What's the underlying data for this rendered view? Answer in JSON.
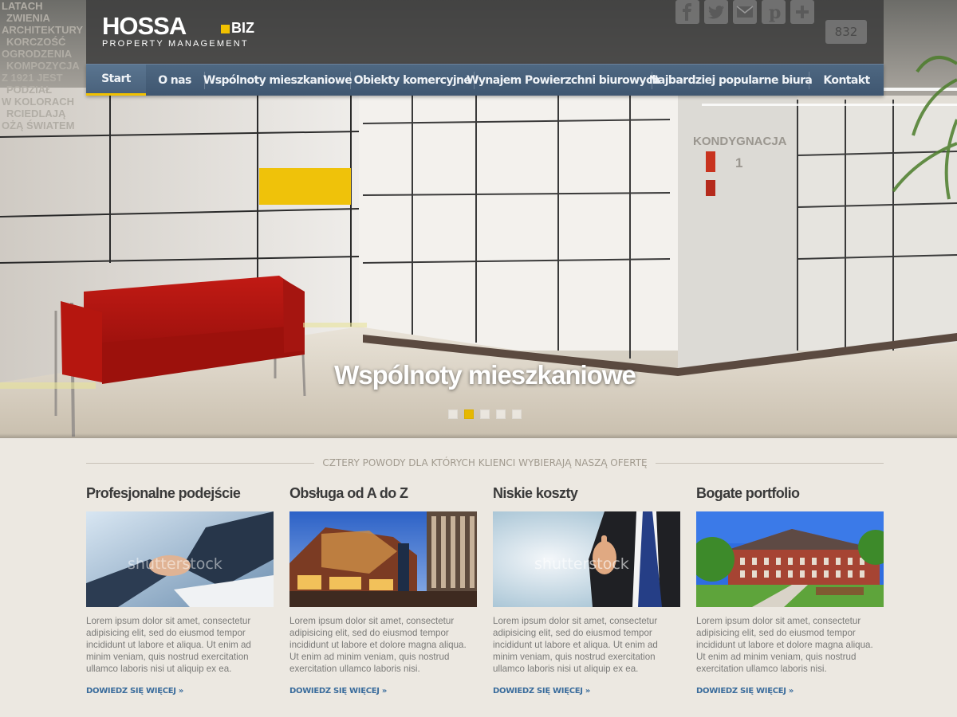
{
  "brand": {
    "name": "HOSSA",
    "tld": "BIZ",
    "tagline": "PROPERTY MANAGEMENT"
  },
  "social": {
    "icons": [
      "facebook-icon",
      "twitter-icon",
      "email-icon",
      "pinterest-icon",
      "plus-icon"
    ],
    "counter": "832"
  },
  "nav": {
    "items": [
      "Start",
      "O nas",
      "Wspólnoty mieszkaniowe",
      "Obiekty komercyjne",
      "Wynajem Powierzchni biurowych",
      "Najbardziej popularne biura",
      "Kontakt"
    ],
    "active_index": 0
  },
  "hero": {
    "caption": "Wspólnoty mieszkaniowe",
    "slides_count": 5,
    "active_slide": 1,
    "wall_sign": "KONDYGNACJA",
    "wall_number": "1",
    "wall_text_lines": [
      "LATACH",
      "ZWIENIA",
      "ARCHITEKTURY",
      "KORCZOŚĆ",
      "OGRODZENIA",
      "KOMPOZYCJA",
      "Z 1921 JEST",
      "PODZIAŁ",
      "W KOLORACH",
      "RCIEDLAJĄ",
      "OŻĄ ŚWIATEM"
    ]
  },
  "reasons": {
    "section_title": "CZTERY POWODY DLA KTÓRYCH KLIENCI WYBIERAJĄ NASZĄ OFERTĘ",
    "more_label": "DOWIEDZ SIĘ WIĘCEJ »",
    "watermark": "shutterstock",
    "items": [
      {
        "title": "Profesjonalne podejście",
        "text": "Lorem ipsum dolor sit amet, consectetur adipisicing elit, sed do eiusmod tempor incididunt ut labore et aliqua. Ut enim ad minim veniam, quis nostrud exercitation ullamco laboris nisi ut aliquip ex ea."
      },
      {
        "title": "Obsługa od A do Z",
        "text": "Lorem ipsum dolor sit amet, consectetur adipisicing elit, sed do eiusmod tempor incididunt ut labore et dolore magna aliqua. Ut enim ad minim veniam, quis nostrud exercitation ullamco laboris nisi."
      },
      {
        "title": "Niskie koszty",
        "text": "Lorem ipsum dolor sit amet, consectetur adipisicing elit, sed do eiusmod tempor incididunt ut labore et aliqua. Ut enim ad minim veniam, quis nostrud exercitation ullamco laboris nisi ut aliquip ex ea."
      },
      {
        "title": "Bogate portfolio",
        "text": "Lorem ipsum dolor sit amet, consectetur adipisicing elit, sed do eiusmod tempor incididunt ut labore et dolore magna aliqua. Ut enim ad minim veniam, quis nostrud exercitation ullamco laboris nisi."
      }
    ]
  },
  "colors": {
    "accent": "#f1c100",
    "nav": "#4a627c",
    "link": "#3a6c9c",
    "background": "#ece8e1"
  }
}
